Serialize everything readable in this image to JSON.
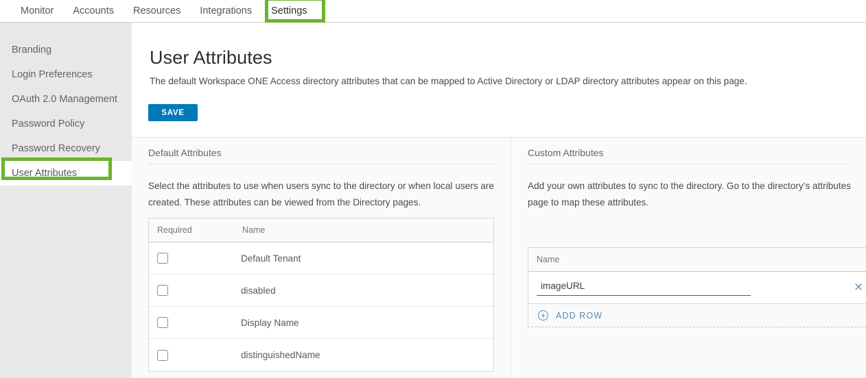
{
  "topnav": {
    "items": [
      {
        "label": "Monitor",
        "active": false
      },
      {
        "label": "Accounts",
        "active": false
      },
      {
        "label": "Resources",
        "active": false
      },
      {
        "label": "Integrations",
        "active": false
      },
      {
        "label": "Settings",
        "active": true
      }
    ]
  },
  "sidebar": {
    "items": [
      {
        "label": "Branding"
      },
      {
        "label": "Login Preferences"
      },
      {
        "label": "OAuth 2.0 Management"
      },
      {
        "label": "Password Policy"
      },
      {
        "label": "Password Recovery"
      },
      {
        "label": "User Attributes"
      }
    ],
    "selected_index": 5
  },
  "main": {
    "title": "User Attributes",
    "description": "The default Workspace ONE Access directory attributes that can be mapped to Active Directory or LDAP directory attributes appear on this page.",
    "save_label": "SAVE"
  },
  "default_attributes": {
    "heading": "Default Attributes",
    "description": "Select the attributes to use when users sync to the directory or when local users are created. These attributes can be viewed from the Directory pages.",
    "columns": [
      "Required",
      "Name"
    ],
    "rows": [
      {
        "required": false,
        "name": "Default Tenant"
      },
      {
        "required": false,
        "name": "disabled"
      },
      {
        "required": false,
        "name": "Display Name"
      },
      {
        "required": false,
        "name": "distinguishedName"
      }
    ]
  },
  "custom_attributes": {
    "heading": "Custom Attributes",
    "description": "Add your own attributes to sync to the directory. Go to the directory’s attributes page to map these attributes.",
    "column_name": "Name",
    "rows": [
      {
        "value": "imageURL",
        "placeholder": "",
        "clear_icon": "close-icon"
      }
    ],
    "add_row_label": "ADD ROW",
    "add_row_icon": "plus-circle-icon"
  },
  "annotations": {
    "highlight_color": "#6cb42d",
    "targets": [
      "Settings",
      "User Attributes"
    ]
  },
  "colors": {
    "accent_button": "#0079b8",
    "link": "#4d8cb5",
    "sidebar_bg": "#e8e8e8",
    "panel_bg": "#fafafa"
  }
}
